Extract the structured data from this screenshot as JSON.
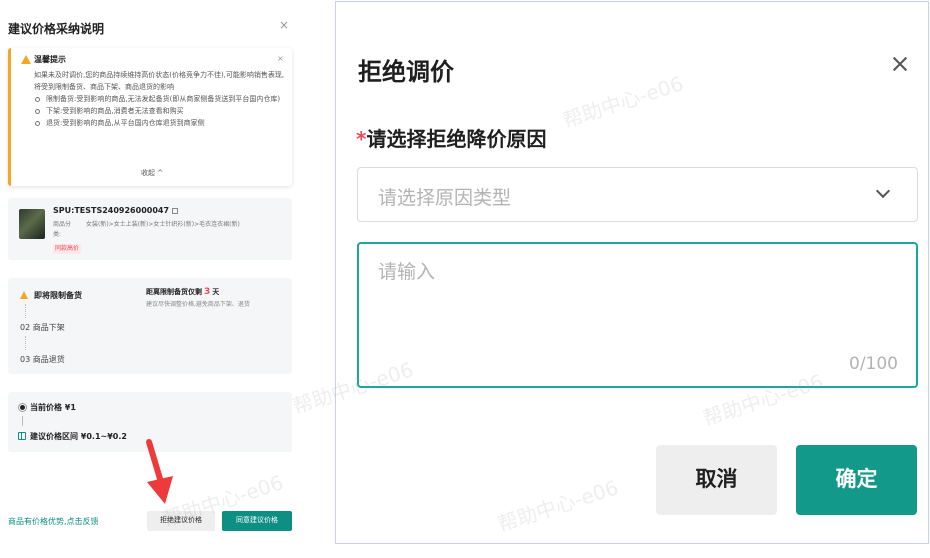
{
  "drawer": {
    "title": "建议价格采纳说明",
    "close": "×",
    "tip": {
      "title": "温馨提示",
      "close": "×",
      "intro": "如果未及时调价,您的商品持续维持高价状态(价格竞争力不佳),可能影响销售表现,将受到限制备货、商品下架、商品退货的影响",
      "items": [
        "限制备货:受到影响的商品,无法发起备货(即从商家侧备货送到平台国内仓库)",
        "下架:受到影响的商品,消费者无法查看和购买",
        "退货:受到影响的商品,从平台国内仓库退货到商家侧"
      ],
      "collapse": "收起 ^"
    },
    "spu": {
      "id": "SPU:TESTS240926000047",
      "category_label": "商品分类:",
      "category_value": "女装(新)>女士上装(新)>女士针织衫(新)>毛衣连衣裙(新)",
      "tag": "同款高价"
    },
    "status": {
      "step1": "即将限制备货",
      "dist_prefix": "距离限制备货仅剩",
      "dist_num": "3",
      "dist_suffix": "天",
      "hint": "建议尽快调整价格,避免商品下架、退货",
      "step2": "02 商品下架",
      "step3": "03 商品退货"
    },
    "price": {
      "current": "当前价格 ¥1",
      "range": "建议价格区间 ¥0.1~¥0.2"
    },
    "footer": {
      "feedback_link": "商品有价格优势,点击反馈",
      "reject_btn": "拒绝建议价格",
      "agree_btn": "同意建议价格"
    }
  },
  "modal": {
    "title": "拒绝调价",
    "required_mark": "*",
    "field_label": "请选择拒绝降价原因",
    "select_placeholder": "请选择原因类型",
    "textarea_placeholder": "请输入",
    "counter": "0/100",
    "cancel": "取消",
    "confirm": "确定"
  },
  "watermark": "帮助中心-e06",
  "colors": {
    "accent": "#12998a",
    "warning": "#f5a623",
    "danger": "#e34d59",
    "focus_border": "#19a99a"
  }
}
